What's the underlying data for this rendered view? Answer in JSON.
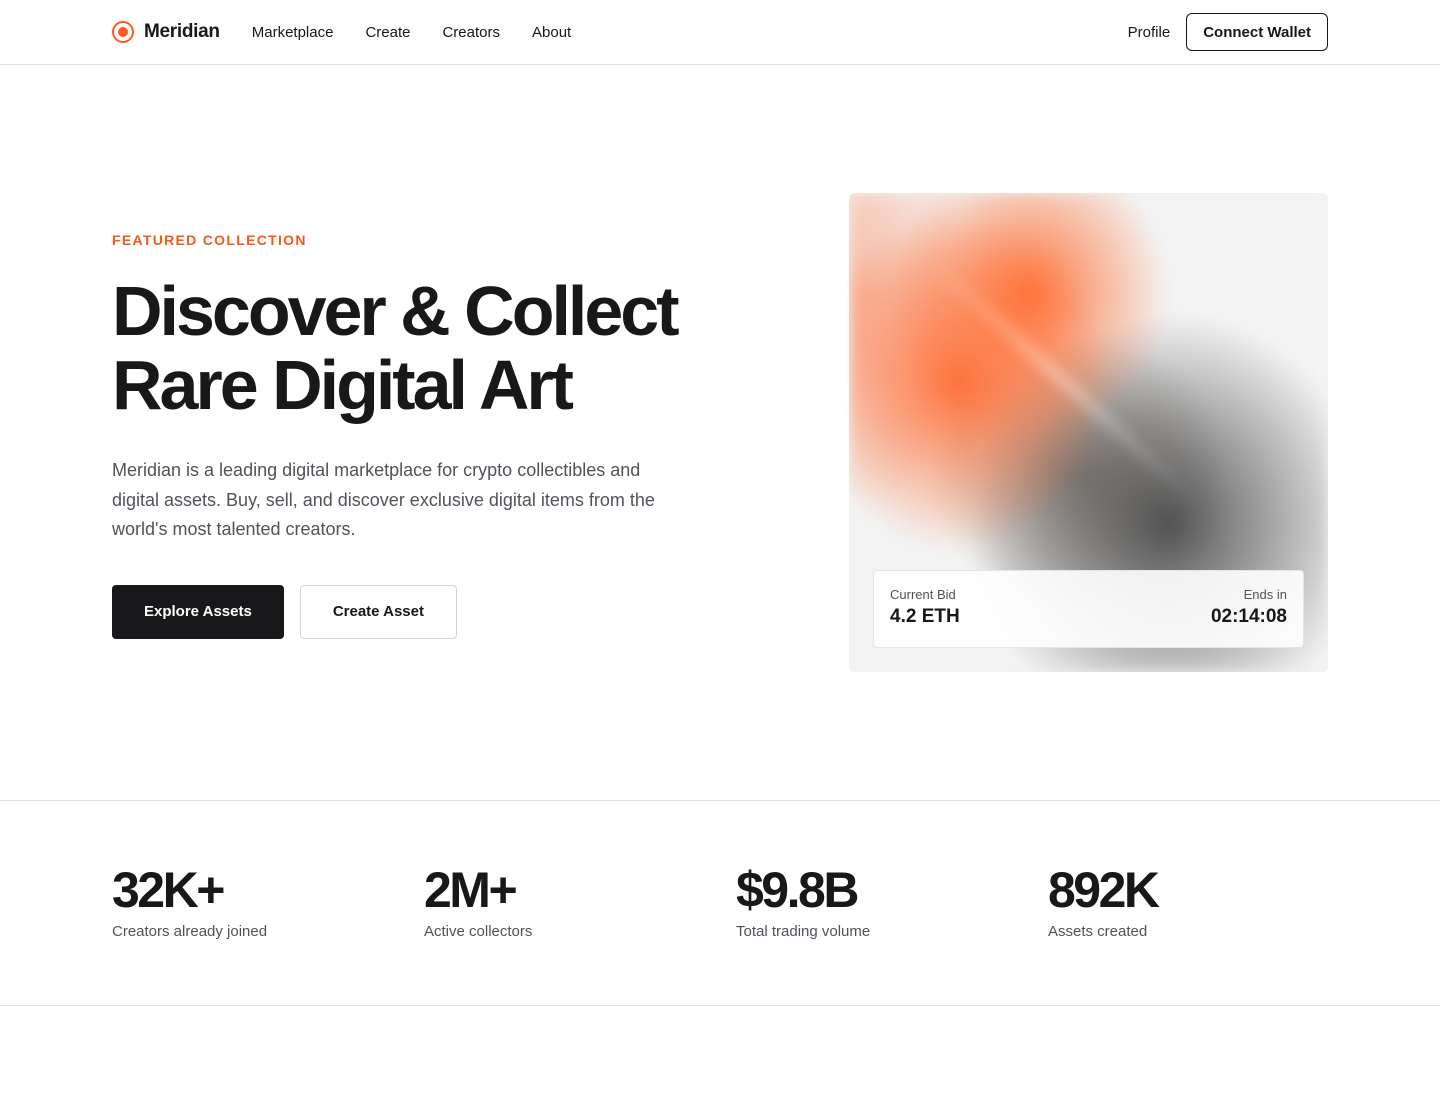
{
  "brand": {
    "name": "Meridian",
    "accent": "#ff5a1f",
    "icon": "radio-target-icon"
  },
  "nav": {
    "items": [
      "Marketplace",
      "Create",
      "Creators",
      "About"
    ],
    "profile_label": "Profile",
    "connect_label": "Connect Wallet"
  },
  "hero": {
    "eyebrow": "FEATURED COLLECTION",
    "title_line1": "Discover & Collect",
    "title_line2": "Rare Digital Art",
    "description": "Meridian is a leading digital marketplace for crypto collectibles and digital assets. Buy, sell, and discover exclusive digital items from the world's most talented creators.",
    "primary_button": "Explore Assets",
    "secondary_button": "Create Asset"
  },
  "featured": {
    "bid_label": "Current Bid",
    "bid_value": "4.2 ETH",
    "ends_label": "Ends in",
    "ends_value": "02:14:08"
  },
  "stats": [
    {
      "value": "32K+",
      "label": "Creators already joined"
    },
    {
      "value": "2M+",
      "label": "Active collectors"
    },
    {
      "value": "$9.8B",
      "label": "Total trading volume"
    },
    {
      "value": "892K",
      "label": "Assets created"
    }
  ]
}
